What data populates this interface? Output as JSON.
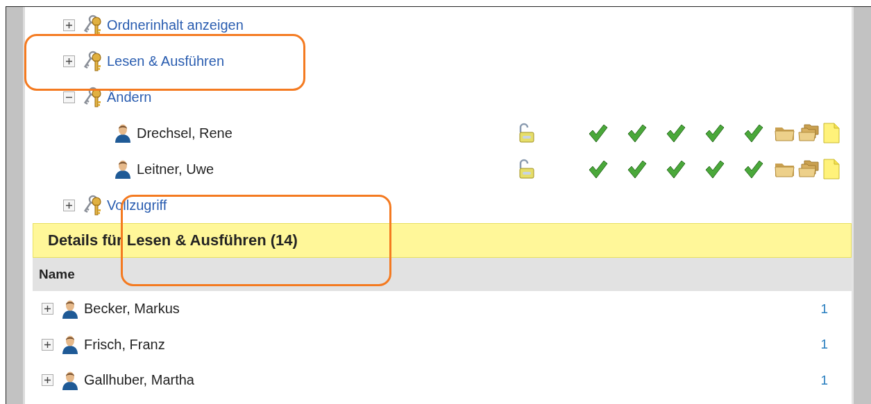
{
  "tree": [
    {
      "label": "Ordnerinhalt anzeigen",
      "expanded": false
    },
    {
      "label": "Lesen & Ausführen",
      "expanded": false
    },
    {
      "label": "Ändern",
      "expanded": true,
      "children": [
        {
          "name": "Drechsel, Rene",
          "rights": [
            true,
            true,
            true,
            true,
            true
          ]
        },
        {
          "name": "Leitner, Uwe",
          "rights": [
            true,
            true,
            true,
            true,
            true
          ]
        }
      ]
    },
    {
      "label": "Vollzugriff",
      "expanded": false
    }
  ],
  "details": {
    "title": "Details für Lesen & Ausführen (14)",
    "columns": [
      "Name"
    ],
    "rows": [
      {
        "name": "Becker, Markus",
        "expanded": false,
        "count": "1"
      },
      {
        "name": "Frisch, Franz",
        "expanded": false,
        "count": "1"
      },
      {
        "name": "Gallhuber, Martha",
        "expanded": false,
        "count": "1"
      }
    ]
  }
}
